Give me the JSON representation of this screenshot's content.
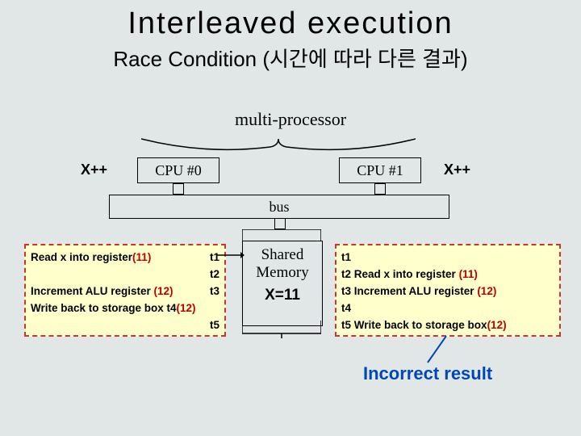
{
  "title": "Interleaved execution",
  "subtitle": "Race Condition (시간에 따라 다른 결과)",
  "multiproc_label": "multi-processor",
  "xpp": "X++",
  "cpu0": "CPU #0",
  "cpu1": "CPU #1",
  "bus": "bus",
  "memory": {
    "line1": "Shared",
    "line2": "Memory",
    "value": "X=11"
  },
  "left": {
    "r1_text": "Read x into register",
    "r1_red": "(11)",
    "r1_t": "t1",
    "r2_t": "t2",
    "r3_text": "Increment ALU register ",
    "r3_red": "(12)",
    "r3_t": "t3",
    "r4_text": "Write back to storage box t4",
    "r4_red": "(12)",
    "r5_t": "t5"
  },
  "right": {
    "r1_t": "t1",
    "r2_t": "t2",
    "r2_text": " Read x into register ",
    "r2_red": "(11)",
    "r3_t": "t3",
    "r3_text": " Increment ALU register ",
    "r3_red": "(12)",
    "r4_t": "t4",
    "r5_t": "t5",
    "r5_text": " Write back to storage box",
    "r5_red": "(12)"
  },
  "incorrect": "Incorrect result"
}
